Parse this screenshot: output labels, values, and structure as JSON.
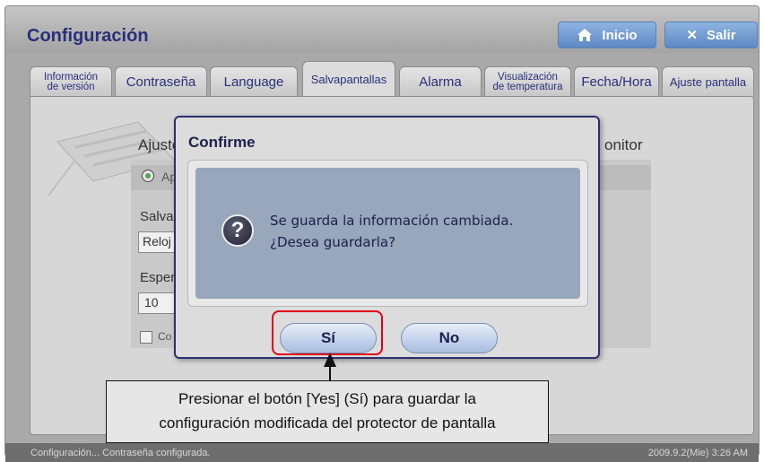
{
  "header": {
    "title": "Configuración",
    "home_label": "Inicio",
    "exit_label": "Salir"
  },
  "tabs": [
    {
      "line1": "Información",
      "line2": "de versión"
    },
    {
      "label": "Contraseña"
    },
    {
      "label": "Language"
    },
    {
      "label": "Salvapantallas"
    },
    {
      "label": "Alarma"
    },
    {
      "line1": "Visualización",
      "line2": "de temperatura"
    },
    {
      "label": "Fecha/Hora"
    },
    {
      "label": "Ajuste pantalla"
    }
  ],
  "background": {
    "ajuste_label": "Ajuste",
    "monitor_label": "onitor",
    "option_label": "Ap",
    "salva_label": "Salva",
    "salva_value": "Reloj",
    "espera_label": "Esper",
    "espera_value": "10",
    "check_label": "Co"
  },
  "dialog": {
    "title": "Confirme",
    "message_line1": "Se guarda la información cambiada.",
    "message_line2": "¿Desea guardarla?",
    "yes_label": "Sí",
    "no_label": "No"
  },
  "callout": {
    "line1": "Presionar el botón [Yes] (Sí) para guardar la",
    "line2": "configuración modificada del protector de pantalla"
  },
  "status": {
    "message": "Configuración... Contraseña configurada.",
    "datetime": "2009.9.2(Mie) 3:26 AM"
  },
  "colors": {
    "accent_blue": "#5e88c5",
    "title_navy": "#2a2f7a",
    "highlight_red": "#e0001a",
    "dialog_inner": "#98a7bb"
  }
}
